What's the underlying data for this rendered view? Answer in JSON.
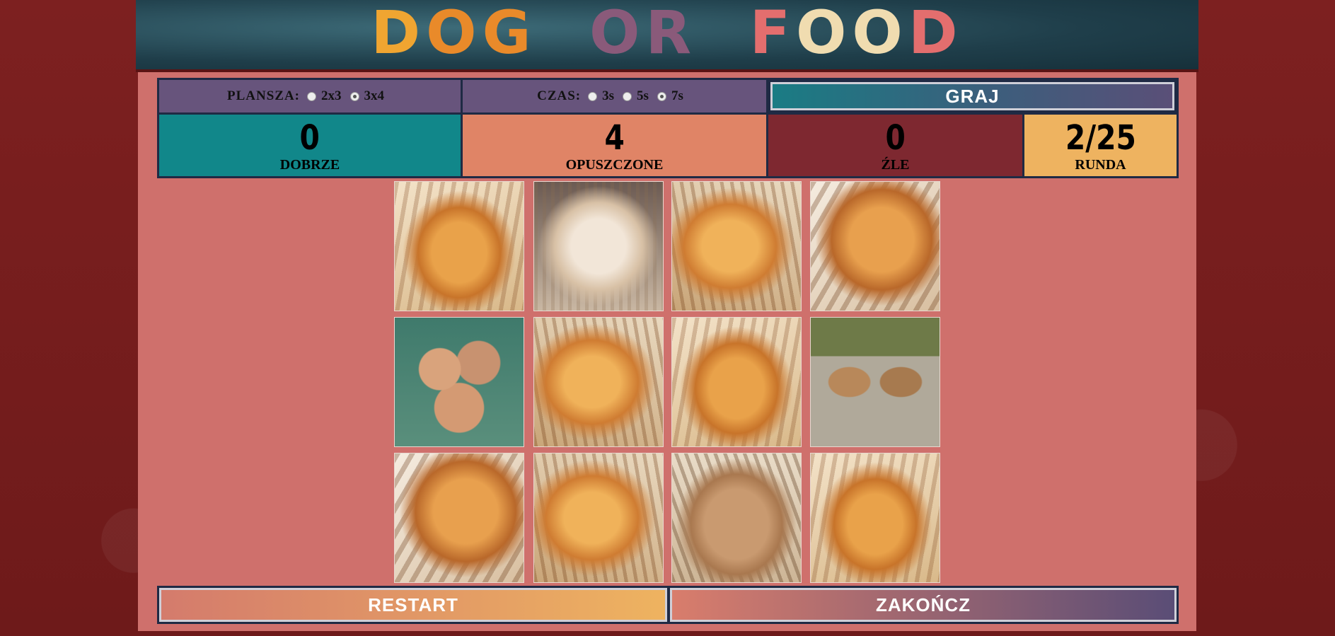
{
  "header": {
    "logo_text": "DOG OR FOOD",
    "logo_parts": [
      "D",
      "O",
      "G",
      " ",
      "OR",
      " ",
      "F",
      "OO",
      "D"
    ]
  },
  "options": {
    "board": {
      "label": "PLANSZA:",
      "choices": [
        "2x3",
        "3x4"
      ],
      "selected": "3x4"
    },
    "time": {
      "label": "CZAS:",
      "choices": [
        "3s",
        "5s",
        "7s"
      ],
      "selected": "7s"
    },
    "play_label": "GRAJ"
  },
  "stats": {
    "correct": {
      "value": "0",
      "label": "DOBRZE"
    },
    "skipped": {
      "value": "4",
      "label": "OPUSZCZONE"
    },
    "wrong": {
      "value": "0",
      "label": "ŹLE"
    },
    "round": {
      "value": "2/25",
      "label": "RUNDA"
    }
  },
  "tiles": [
    {
      "kind": "croissant"
    },
    {
      "kind": "dog"
    },
    {
      "kind": "croissant"
    },
    {
      "kind": "croissant"
    },
    {
      "kind": "dog"
    },
    {
      "kind": "croissant"
    },
    {
      "kind": "croissant"
    },
    {
      "kind": "dog"
    },
    {
      "kind": "croissant"
    },
    {
      "kind": "croissant"
    },
    {
      "kind": "dog"
    },
    {
      "kind": "croissant"
    }
  ],
  "footer": {
    "restart_label": "RESTART",
    "finish_label": "ZAKOŃCZ"
  },
  "colors": {
    "correct": "#11878a",
    "skipped": "#e08466",
    "wrong": "#7e2830",
    "round": "#eeb360",
    "options_bg": "#67547c",
    "panel_bg": "#cf706c"
  }
}
